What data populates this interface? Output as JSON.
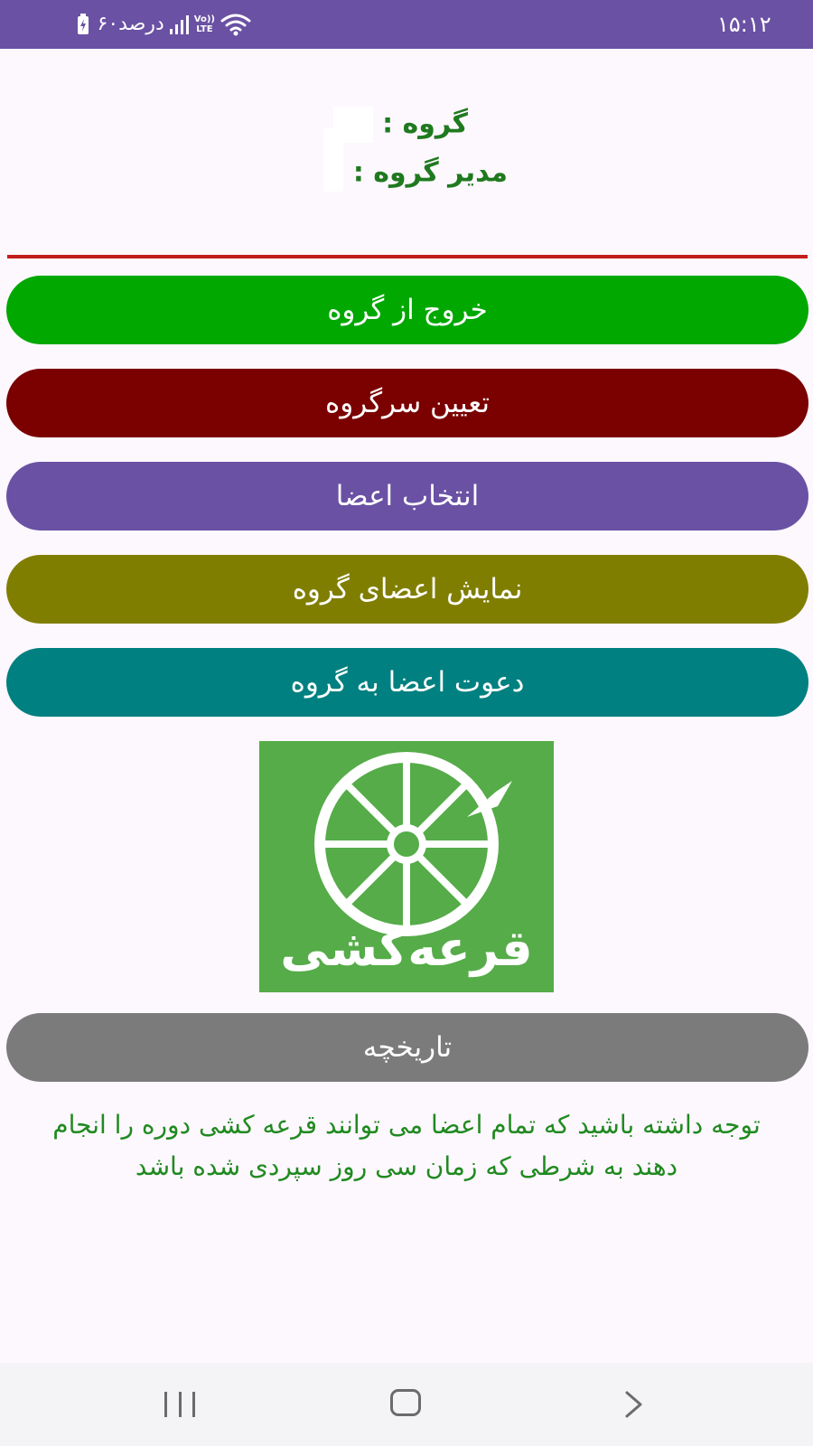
{
  "status_bar": {
    "time": "۱۵:۱۲",
    "battery_text": "۶۰درصد",
    "network_label_top": "Vo))",
    "network_label_bottom": "LTE",
    "icons": [
      "wifi-icon",
      "signal-icon",
      "battery-icon"
    ]
  },
  "group_info": {
    "group_label": "گروه :",
    "manager_label": "مدیر گروه :"
  },
  "buttons": {
    "leave_group": "خروج از گروه",
    "assign_leader": "تعیین سرگروه",
    "select_members": "انتخاب اعضا",
    "show_members": "نمایش اعضای گروه",
    "invite_members": "دعوت اعضا به گروه",
    "history": "تاریخچه"
  },
  "lottery_image": {
    "text": "قرعه‌کشی",
    "icon": "lottery-wheel-icon"
  },
  "note": "توجه داشته باشید که تمام اعضا می توانند قرعه کشی دوره را انجام دهند به شرطی که زمان سی روز سپردی شده باشد",
  "colors": {
    "status_bar": "#6A51A4",
    "background": "#FDF7FE",
    "title_text": "#1F7A1F",
    "divider": "#C21E1E",
    "leave_button": "#00A800",
    "leader_button": "#7B0000",
    "select_button": "#6A51A4",
    "show_button": "#807E00",
    "invite_button": "#008080",
    "history_button": "#7B7B7B",
    "lottery_bg": "#55AC48",
    "note_text": "#1F8A1F"
  },
  "nav_bar": {
    "icons": [
      "recent-apps-icon",
      "home-icon",
      "back-icon"
    ]
  }
}
